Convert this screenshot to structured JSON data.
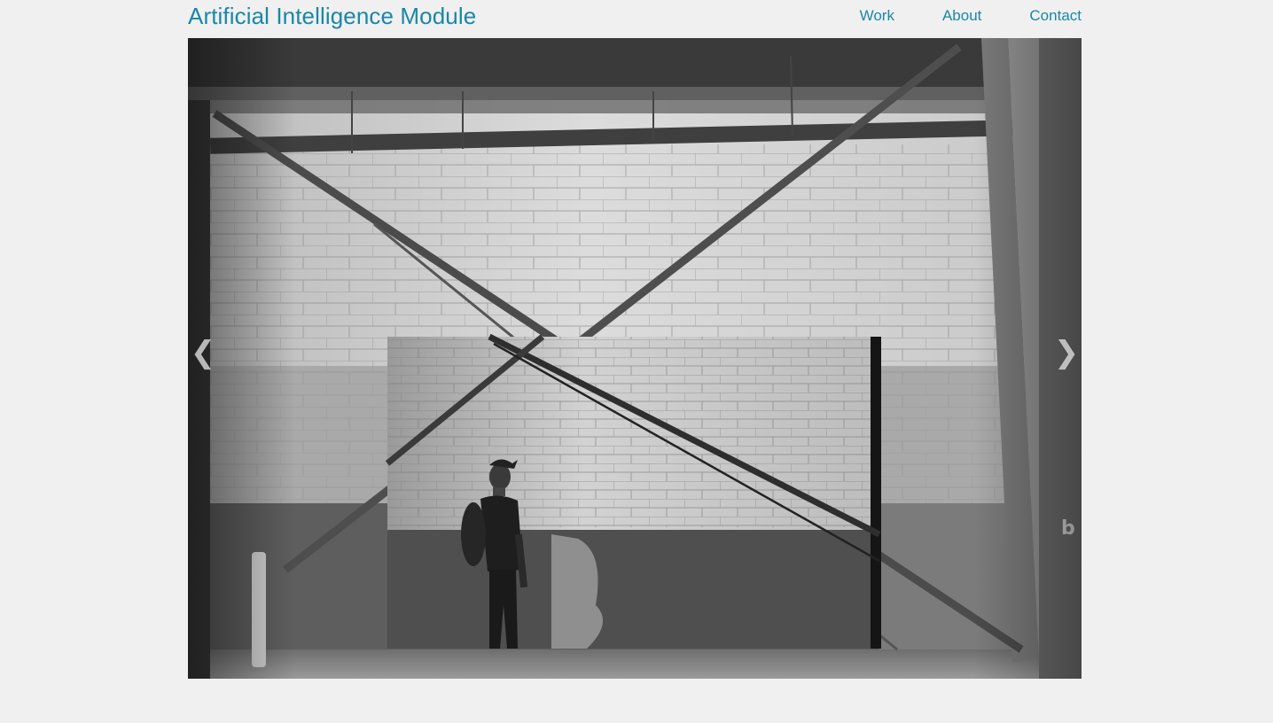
{
  "header": {
    "site_title": "Artificial Intelligence Module",
    "nav": [
      {
        "label": "Work"
      },
      {
        "label": "About"
      },
      {
        "label": "Contact"
      }
    ]
  },
  "slideshow": {
    "prev_icon": "chevron-left-icon",
    "next_icon": "chevron-right-icon",
    "prev_glyph": "❮",
    "next_glyph": "❯",
    "graffiti_letter": "b"
  },
  "colors": {
    "accent": "#1a87a7",
    "background": "#f0f0f0"
  }
}
